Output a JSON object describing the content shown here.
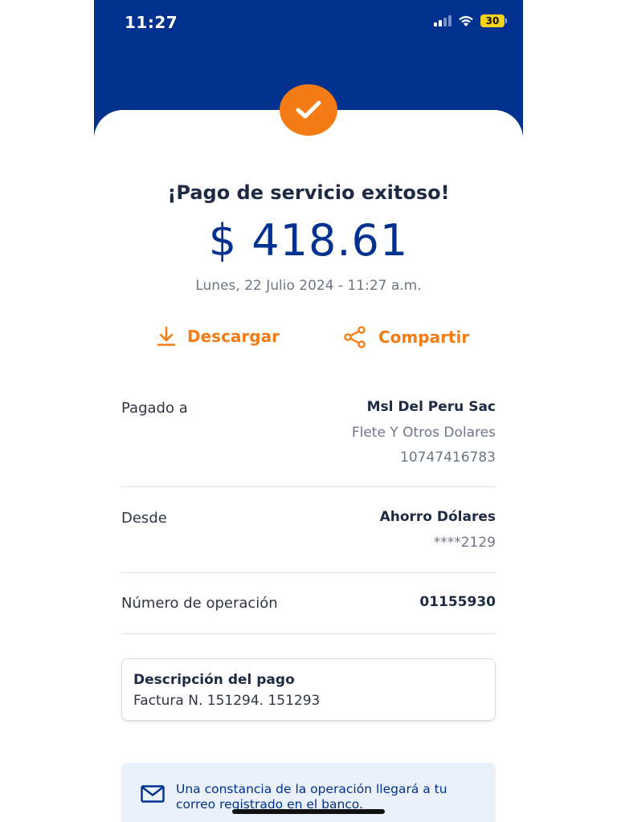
{
  "status_bar": {
    "time": "11:27",
    "battery": "30"
  },
  "receipt": {
    "title": "¡Pago de servicio exitoso!",
    "amount": "$ 418.61",
    "datetime": "Lunes, 22 Julio 2024 - 11:27 a.m."
  },
  "actions": {
    "download_label": "Descargar",
    "share_label": "Compartir"
  },
  "details": {
    "paid_to": {
      "label": "Pagado a",
      "name": "Msl Del Peru Sac",
      "service": "Flete Y Otros Dolares",
      "code": "10747416783"
    },
    "from": {
      "label": "Desde",
      "account": "Ahorro Dólares",
      "number": "****2129"
    },
    "operation": {
      "label": "Número de operación",
      "value": "01155930"
    }
  },
  "description": {
    "title": "Descripción del pago",
    "text": "Factura N. 151294. 151293"
  },
  "notice": {
    "text": "Una constancia de la operación llegará a tu correo registrado en el banco."
  },
  "colors": {
    "brand_blue": "#00318f",
    "accent_orange": "#f57c14",
    "battery_yellow": "#f2d21b"
  },
  "icons": {
    "success": "check-icon",
    "download": "download-icon",
    "share": "share-icon",
    "notice": "mail-icon"
  }
}
